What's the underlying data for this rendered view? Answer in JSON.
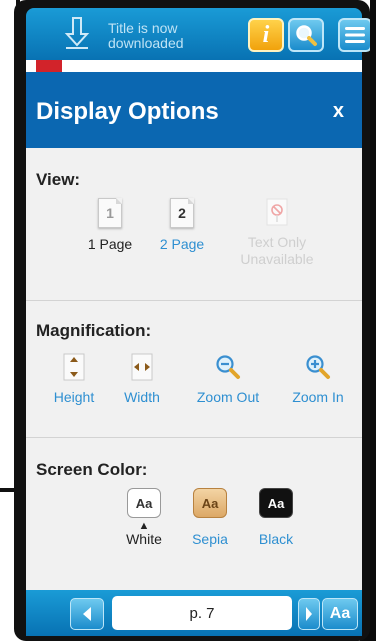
{
  "topbar": {
    "download_status": "Title is now downloaded",
    "download_status_line1": "Title is now",
    "download_status_line2": "downloaded"
  },
  "panel": {
    "title": "Display Options",
    "close_label": "x",
    "view": {
      "title": "View:",
      "options": [
        {
          "icon_text": "1",
          "label": "1 Page",
          "color": "#222222"
        },
        {
          "icon_text": "2",
          "label": "2 Page",
          "color": "#2e8fd1"
        },
        {
          "label_line1": "Text Only",
          "label_line2": "Unavailable",
          "color": "#cfcfcf"
        }
      ]
    },
    "magnification": {
      "title": "Magnification:",
      "options": [
        {
          "label": "Height"
        },
        {
          "label": "Width"
        },
        {
          "label": "Zoom Out"
        },
        {
          "label": "Zoom In"
        }
      ],
      "label_color": "#2e8fd1"
    },
    "screen_color": {
      "title": "Screen Color:",
      "swatch_text": "Aa",
      "options": [
        {
          "label": "White",
          "selected": true
        },
        {
          "label": "Sepia"
        },
        {
          "label": "Black"
        }
      ]
    }
  },
  "bottombar": {
    "page_label": "p. 7",
    "font_button": "Aa"
  },
  "colors": {
    "topbar": "#1288c7",
    "panel_header": "#0b67b1",
    "accent_link": "#2e8fd1",
    "info_button": "#f1a20c"
  }
}
